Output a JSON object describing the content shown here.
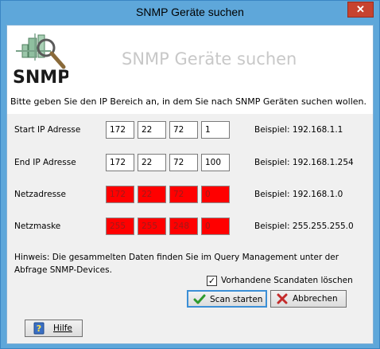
{
  "window": {
    "title": "SNMP Geräte suchen",
    "close_label": "✕"
  },
  "header": {
    "logo_text": "SNMP",
    "title": "SNMP Geräte suchen",
    "instruction": "Bitte geben Sie den IP Bereich an, in dem Sie nach SNMP Geräten suchen wollen."
  },
  "rows": [
    {
      "label": "Start IP Adresse",
      "octets": [
        "172",
        "22",
        "72",
        "1"
      ],
      "example": "Beispiel: 192.168.1.1",
      "readonly": false
    },
    {
      "label": "End IP Adresse",
      "octets": [
        "172",
        "22",
        "72",
        "100"
      ],
      "example": "Beispiel: 192.168.1.254",
      "readonly": false
    },
    {
      "label": "Netzadresse",
      "octets": [
        "172",
        "22",
        "72",
        "0"
      ],
      "example": "Beispiel: 192.168.1.0",
      "readonly": true
    },
    {
      "label": "Netzmaske",
      "octets": [
        "255",
        "255",
        "248",
        "0"
      ],
      "example": "Beispiel: 255.255.255.0",
      "readonly": true
    }
  ],
  "hint": "Hinweis: Die gesammelten Daten finden Sie im Query Management unter der Abfrage SNMP-Devices.",
  "checkbox": {
    "label": "Vorhandene Scandaten löschen",
    "checked": true
  },
  "buttons": {
    "scan": "Scan starten",
    "cancel": "Abbrechen",
    "help": "Hilfe"
  },
  "colors": {
    "titlebar": "#5ea7da",
    "readonly_field": "#ff0000",
    "readonly_text": "#9e1a1a",
    "close_button": "#c7432f"
  },
  "icons": {
    "scan": "checkmark-icon",
    "cancel": "x-mark-icon",
    "help": "question-book-icon",
    "logo": "snmp-magnifier-logo"
  }
}
